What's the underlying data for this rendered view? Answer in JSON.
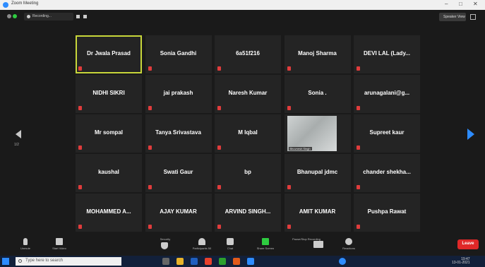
{
  "window": {
    "title": "Zoom Meeting",
    "controls": [
      "–",
      "□",
      "✕"
    ]
  },
  "topbar": {
    "recording_label": "Recording...",
    "speaker_view_label": "Speaker View"
  },
  "participants": [
    [
      "Dr Jwala Prasad",
      "Sonia Gandhi",
      "6a51f216",
      "Manoj Sharma",
      "DEVI LAL (Lady..."
    ],
    [
      "NIDHI SIKRI",
      "jai prakash",
      "Naresh Kumar",
      "Sonia .",
      "arunagalani@g..."
    ],
    [
      "Mr sompal",
      "Tanya Srivastava",
      "M Iqbal",
      "",
      "Supreet kaur"
    ],
    [
      "kaushal",
      "Swati Gaur",
      "bp",
      "Bhanupal jdmc",
      "chander shekha..."
    ],
    [
      "MOHAMMED A...",
      "AJAY KUMAR",
      "ARVIND SINGH...",
      "AMIT KUMAR",
      "Pushpa Rawat"
    ]
  ],
  "active_speaker": "Dr Jwala Prasad",
  "video_tile_label": "Bhuvnesh Singh",
  "page_nav": {
    "left_page": "1/2"
  },
  "toolbar": {
    "unmute_label": "Unmute",
    "start_video_label": "Start Video",
    "security_label": "Security",
    "participants_label": "Participants",
    "participants_count": "50",
    "chat_label": "Chat",
    "share_screen_label": "Share Screen",
    "pause_record_label": "Pause/Stop Recording",
    "reactions_label": "Reactions",
    "leave_label": "Leave"
  },
  "taskbar": {
    "search_placeholder": "Type here to search",
    "time": "19:47",
    "date": "13-01-2021"
  },
  "colors": {
    "active_outline": "#c8d63a",
    "muted_mic": "#e03c3c",
    "leave_button": "#e02828",
    "accent_blue": "#2d8cff",
    "share_green": "#2ecc40"
  }
}
